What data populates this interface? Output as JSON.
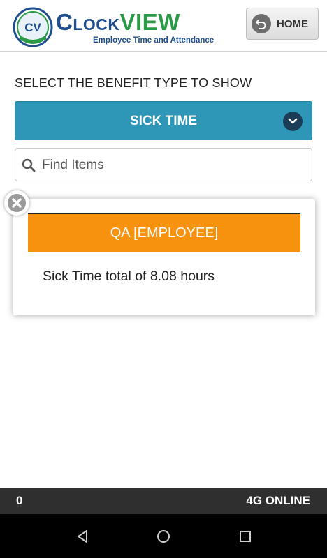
{
  "header": {
    "logo": {
      "badge_text": "CV",
      "title_part1": "Clock",
      "title_part2": "VIEW",
      "subtitle": "Employee Time and Attendance"
    },
    "home_button": {
      "label": "HOME",
      "icon": "undo-arrow-icon"
    }
  },
  "main": {
    "section_title": "SELECT THE BENEFIT TYPE TO SHOW",
    "benefit_select": {
      "selected": "SICK TIME",
      "icon": "chevron-down-icon"
    },
    "search": {
      "placeholder": "Find Items",
      "value": ""
    },
    "result_card": {
      "header": "QA [EMPLOYEE]",
      "text": "Sick Time total of 8.08 hours"
    }
  },
  "status_bar": {
    "left": "0",
    "right": "4G ONLINE"
  },
  "colors": {
    "select_bg": "#2e97b8",
    "card_header_bg": "#f7920f",
    "brand_blue": "#1f4f8f",
    "brand_green": "#2a9a47"
  }
}
